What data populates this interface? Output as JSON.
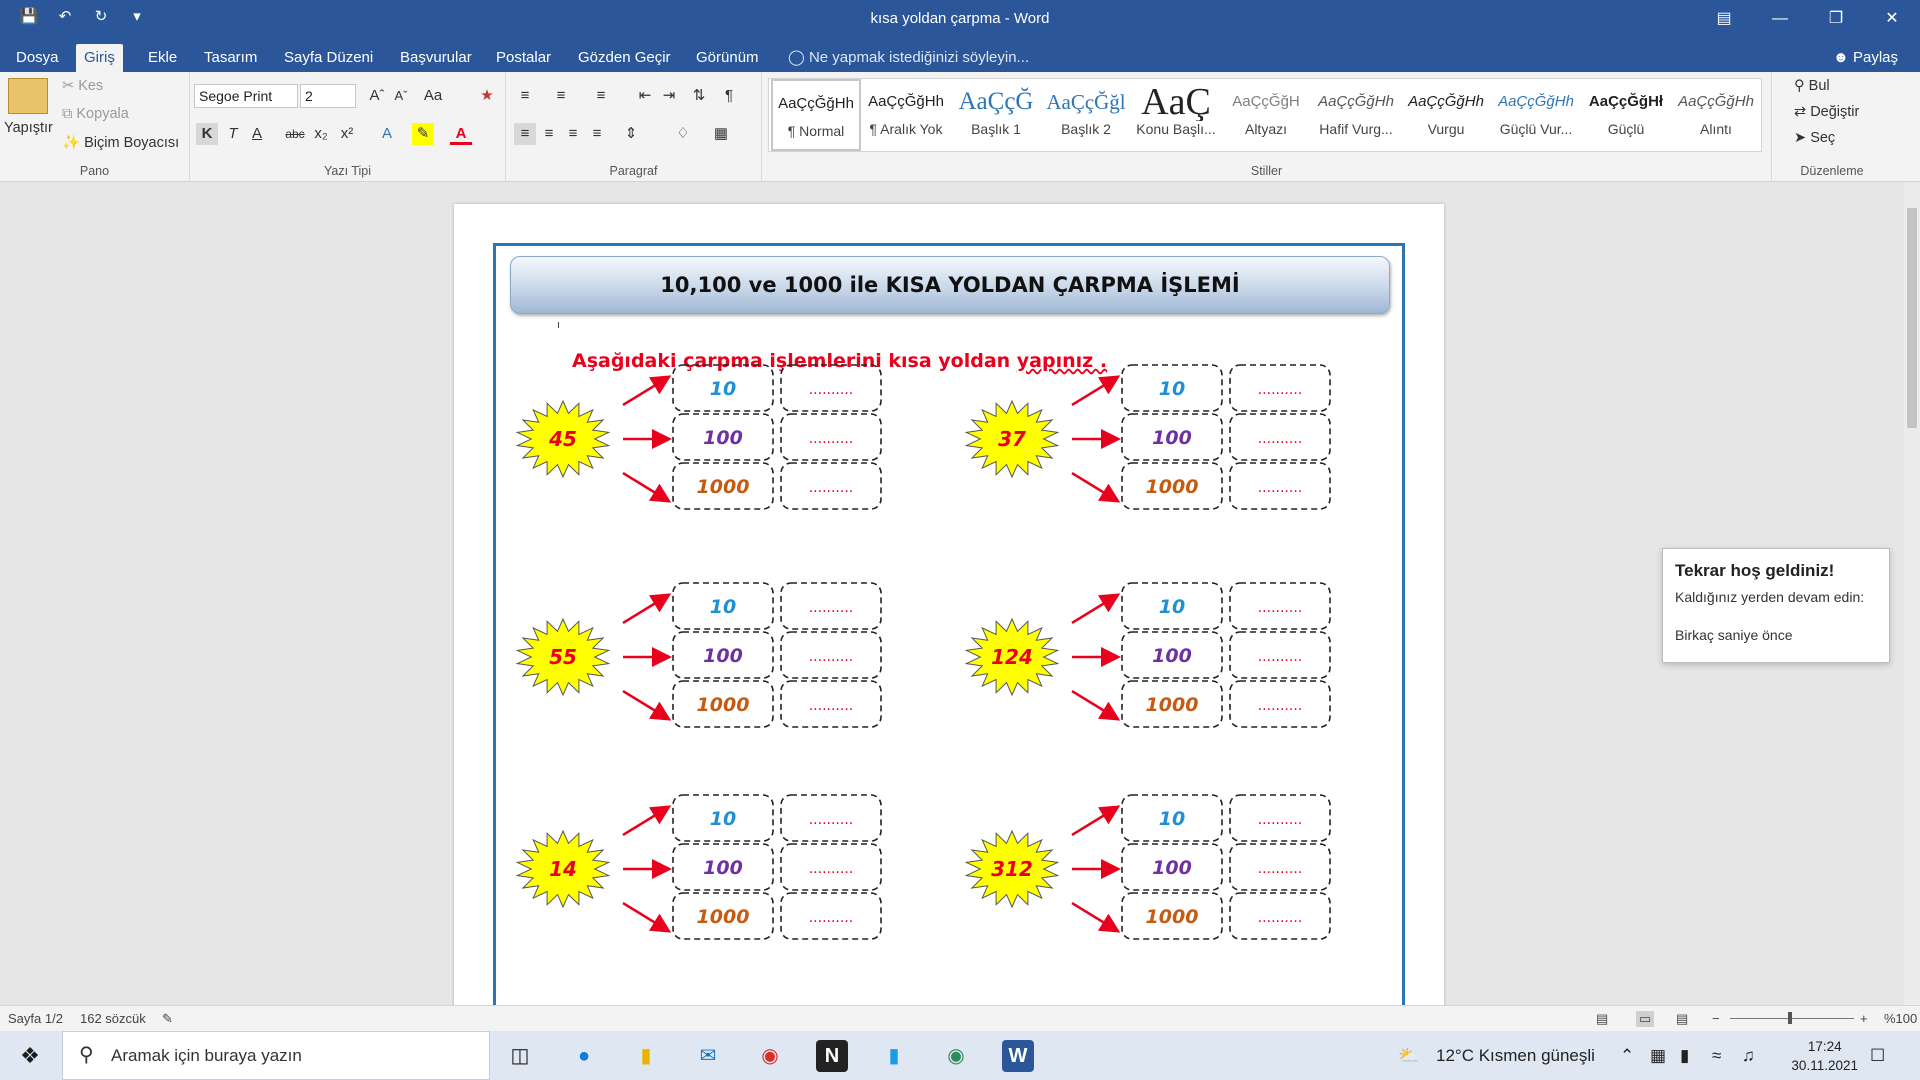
{
  "window": {
    "title": "kısa yoldan çarpma - Word",
    "tabs": [
      "Dosya",
      "Giriş",
      "Ekle",
      "Tasarım",
      "Sayfa Düzeni",
      "Başvurular",
      "Postalar",
      "Gözden Geçir",
      "Görünüm"
    ],
    "active_tab": "Giriş",
    "tell_me": "Ne yapmak istediğinizi söyleyin...",
    "share": "Paylaş"
  },
  "ribbon": {
    "clipboard": {
      "paste": "Yapıştır",
      "cut": "Kes",
      "copy": "Kopyala",
      "format_painter": "Biçim Boyacısı",
      "label": "Pano"
    },
    "font": {
      "family": "Segoe Print",
      "size": "2",
      "label": "Yazı Tipi",
      "bold": "K",
      "italic": "T",
      "underline": "A",
      "strike": "abc",
      "sub": "x₂",
      "sup": "x²",
      "case": "Aa"
    },
    "paragraph": {
      "label": "Paragraf"
    },
    "styles": {
      "label": "Stiller",
      "items": [
        {
          "preview": "AaÇçĞğHh",
          "name": "¶ Normal"
        },
        {
          "preview": "AaÇçĞğHh",
          "name": "¶ Aralık Yok"
        },
        {
          "preview": "AaÇçĞ",
          "name": "Başlık 1"
        },
        {
          "preview": "AaÇçĞğl",
          "name": "Başlık 2"
        },
        {
          "preview": "AaÇ",
          "name": "Konu Başlı..."
        },
        {
          "preview": "AaÇçĞğH",
          "name": "Altyazı"
        },
        {
          "preview": "AaÇçĞğHh",
          "name": "Hafif Vurg..."
        },
        {
          "preview": "AaÇçĞğHh",
          "name": "Vurgu"
        },
        {
          "preview": "AaÇçĞğHh",
          "name": "Güçlü Vur..."
        },
        {
          "preview": "AaÇçĞğHł",
          "name": "Güçlü"
        },
        {
          "preview": "AaÇçĞğHh",
          "name": "Alıntı"
        }
      ]
    },
    "editing": {
      "label": "Düzenleme",
      "find": "Bul",
      "replace": "Değiştir",
      "select": "Seç"
    }
  },
  "document": {
    "heading": "10,100 ve 1000 ile KISA YOLDAN ÇARPMA İŞLEMİ",
    "instruction_main": "Aşağıdaki çarpma işlemlerini kısa yoldan ",
    "instruction_squiggle": "yapınız .",
    "multipliers": [
      "10",
      "100",
      "1000"
    ],
    "blank": "..........",
    "exercises": [
      "45",
      "37",
      "55",
      "124",
      "14",
      "312"
    ]
  },
  "popup": {
    "title": "Tekrar hoş geldiniz!",
    "text": "Kaldığınız yerden devam edin:",
    "time": "Birkaç saniye önce"
  },
  "status": {
    "page": "Sayfa 1/2",
    "words": "162 sözcük",
    "zoom": "%100"
  },
  "taskbar": {
    "search_placeholder": "Aramak için buraya yazın",
    "weather": "12°C  Kısmen güneşli",
    "time": "17:24",
    "date": "30.11.2021"
  },
  "colors": {
    "word_blue": "#2b579a",
    "star_yellow": "#ffff00",
    "arrow_red": "#e8001c",
    "m10": "#1f8fd6",
    "m100": "#7030a0",
    "m1000": "#c55a11"
  }
}
